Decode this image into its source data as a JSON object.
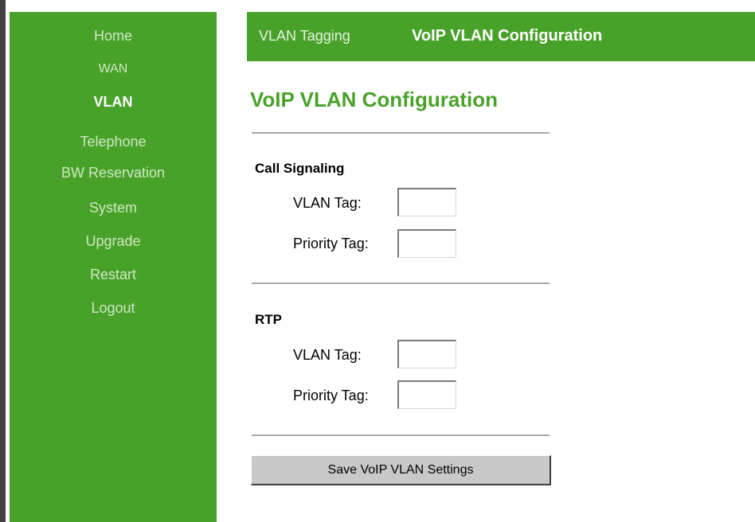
{
  "sidebar": {
    "items": [
      {
        "label": "Home"
      },
      {
        "label": "WAN"
      },
      {
        "label": "VLAN"
      },
      {
        "label": "Telephone"
      },
      {
        "label": "BW Reservation"
      },
      {
        "label": "System"
      },
      {
        "label": "Upgrade"
      },
      {
        "label": "Restart"
      },
      {
        "label": "Logout"
      }
    ],
    "active": "VLAN"
  },
  "tabs": [
    {
      "label": "VLAN Tagging"
    },
    {
      "label": "VoIP VLAN Configuration"
    }
  ],
  "page_title": "VoIP VLAN Configuration",
  "sections": [
    {
      "heading": "Call Signaling",
      "vlan_tag_label": "VLAN Tag:",
      "vlan_tag_value": "",
      "priority_tag_label": "Priority Tag:",
      "priority_tag_value": ""
    },
    {
      "heading": "RTP",
      "vlan_tag_label": "VLAN Tag:",
      "vlan_tag_value": "",
      "priority_tag_label": "Priority Tag:",
      "priority_tag_value": ""
    }
  ],
  "save_button_label": "Save VoIP VLAN Settings",
  "colors": {
    "brand_green": "#48a22a",
    "menu_text": "#cfe7c2",
    "active_text": "#ffffff",
    "rule": "#a8a8a8"
  }
}
